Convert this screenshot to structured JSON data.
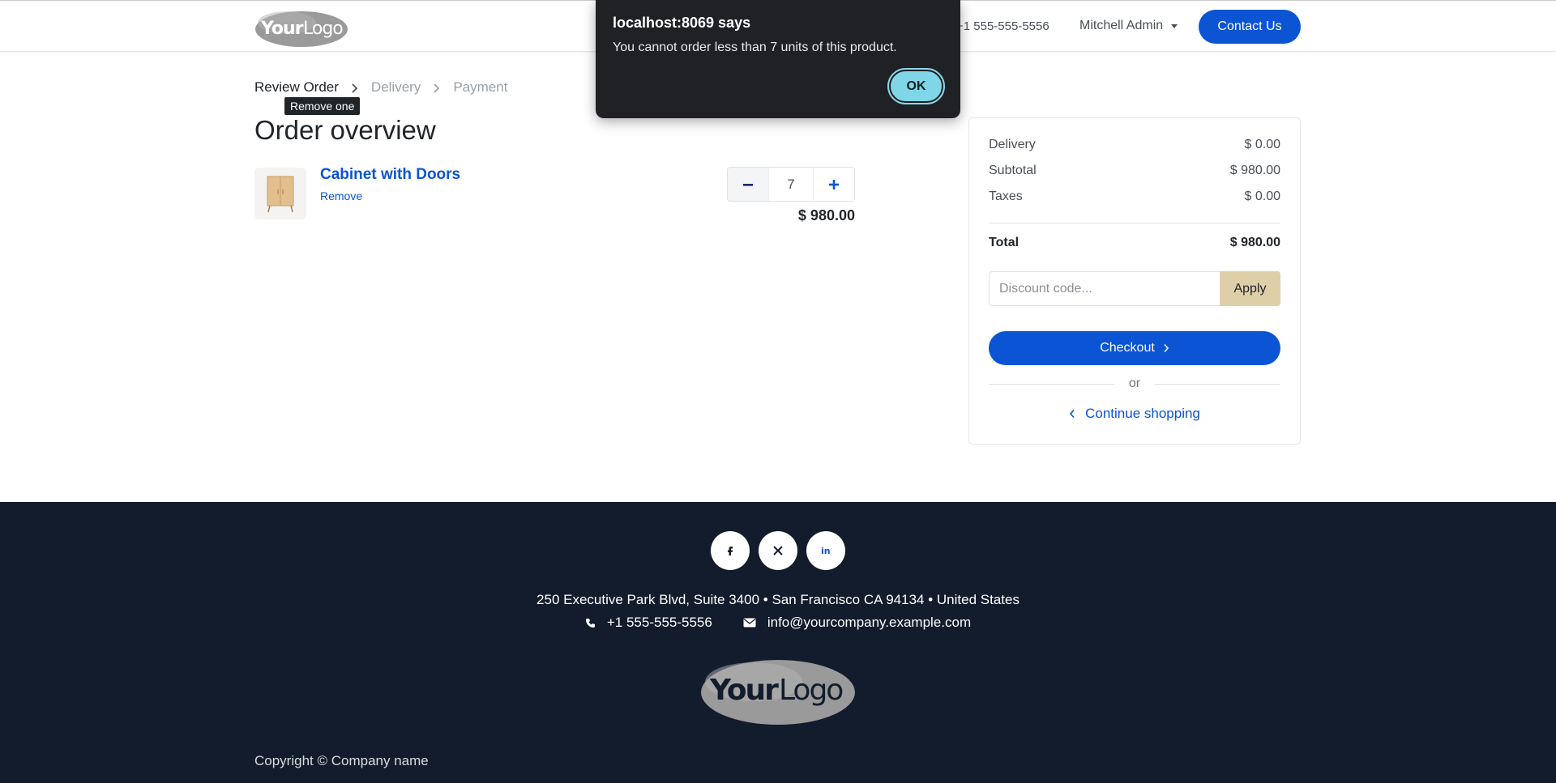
{
  "header": {
    "logo_text": "YourLogo",
    "phone": "+1 555-555-5556",
    "user_name": "Mitchell Admin",
    "contact_label": "Contact Us"
  },
  "steps": [
    {
      "label": "Review Order",
      "active": true
    },
    {
      "label": "Delivery",
      "active": false
    },
    {
      "label": "Payment",
      "active": false
    }
  ],
  "tooltip": "Remove one",
  "page_title": "Order overview",
  "product": {
    "name": "Cabinet with Doors",
    "remove_label": "Remove",
    "quantity": "7",
    "price": "$ 980.00"
  },
  "summary": {
    "delivery_label": "Delivery",
    "delivery_value": "$ 0.00",
    "subtotal_label": "Subtotal",
    "subtotal_value": "$ 980.00",
    "taxes_label": "Taxes",
    "taxes_value": "$ 0.00",
    "total_label": "Total",
    "total_value": "$ 980.00",
    "discount_placeholder": "Discount code...",
    "apply_label": "Apply",
    "checkout_label": "Checkout",
    "or_label": "or",
    "continue_label": "Continue shopping"
  },
  "footer": {
    "address": "250 Executive Park Blvd, Suite 3400 • San Francisco CA 94134 • United States",
    "phone": "+1 555-555-5556",
    "email": "info@yourcompany.example.com",
    "copyright": "Copyright © Company name",
    "social": [
      "facebook-icon",
      "x-twitter-icon",
      "linkedin-icon"
    ]
  },
  "dialog": {
    "title": "localhost:8069 says",
    "message": "You cannot order less than 7 units of this product.",
    "ok_label": "OK"
  },
  "colors": {
    "primary": "#0b54d3",
    "footer_bg": "#131c2c",
    "apply_bg": "#dfcfa9",
    "dialog_bg": "#202124",
    "ok_bg": "#7fd6e6"
  }
}
